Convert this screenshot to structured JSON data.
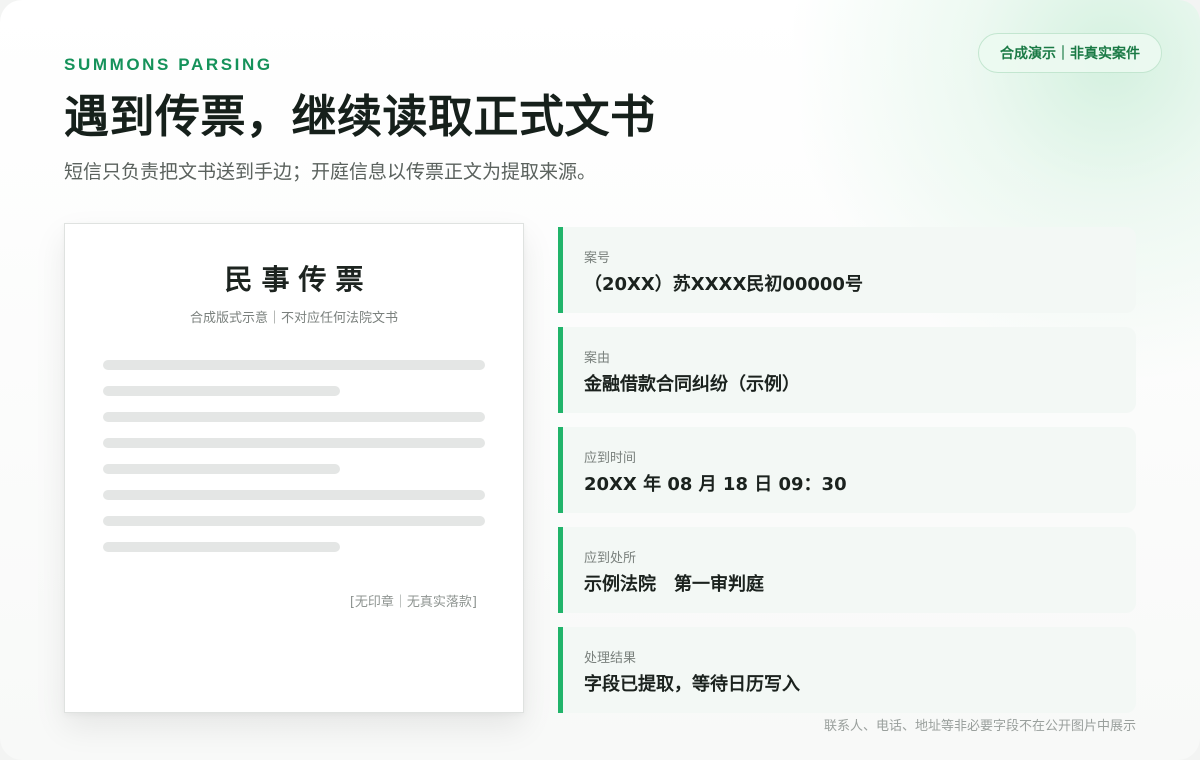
{
  "header": {
    "eyebrow": "SUMMONS PARSING",
    "title": "遇到传票，继续读取正式文书",
    "subtitle": "短信只负责把文书送到手边；开庭信息以传票正文为提取来源。",
    "badge": "合成演示｜非真实案件"
  },
  "document": {
    "title": "民事传票",
    "subtitle": "合成版式示意｜不对应任何法院文书",
    "stamp_note": "[无印章｜无真实落款]"
  },
  "fields": [
    {
      "label": "案号",
      "value": "（20XX）苏XXXX民初00000号"
    },
    {
      "label": "案由",
      "value": "金融借款合同纠纷（示例）"
    },
    {
      "label": "应到时间",
      "value": "20XX 年 08 月 18 日 09：30"
    },
    {
      "label": "应到处所",
      "value": "示例法院　第一审判庭"
    },
    {
      "label": "处理结果",
      "value": "字段已提取，等待日历写入"
    }
  ],
  "footnote": "联系人、电话、地址等非必要字段不在公开图片中展示",
  "colors": {
    "accent": "#21b46a",
    "eyebrow": "#15925a",
    "badge_text": "#1a7a45"
  }
}
